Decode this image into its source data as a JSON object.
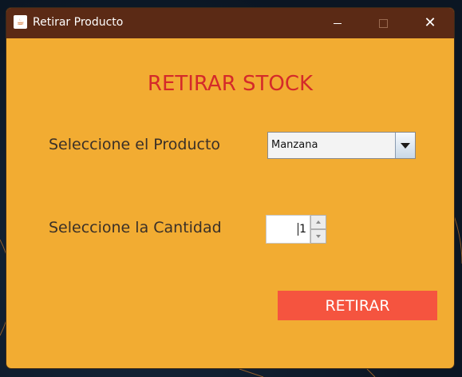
{
  "window": {
    "title": "Retirar Producto",
    "app_icon": "java-cup-icon",
    "controls": {
      "minimize_icon": "minimize-icon",
      "maximize_icon": "maximize-icon",
      "close_icon": "close-icon",
      "close_glyph": "✕"
    }
  },
  "form": {
    "heading": "RETIRAR STOCK",
    "producto_label": "Seleccione el Producto",
    "producto_selected": "Manzana",
    "cantidad_label": "Seleccione la Cantidad",
    "cantidad_value": "1",
    "submit_label": "RETIRAR"
  },
  "colors": {
    "window_background": "#f2ac32",
    "titlebar": "#5b2a15",
    "heading": "#d42a2a",
    "button": "#f5543f",
    "label": "#3a3028"
  }
}
